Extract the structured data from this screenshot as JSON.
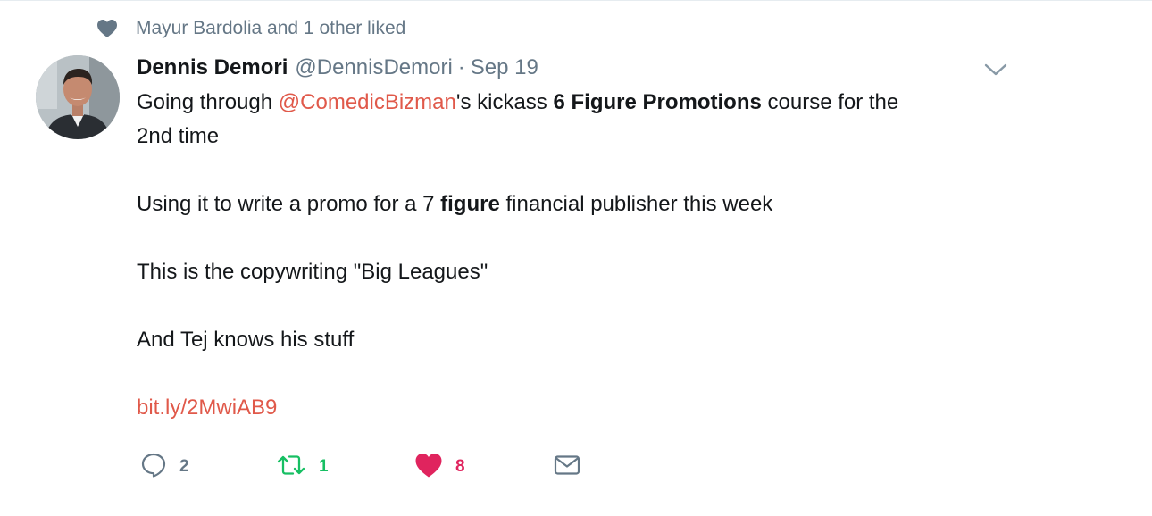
{
  "context": {
    "text": "Mayur Bardolia and 1 other liked",
    "icon": "heart-icon"
  },
  "tweet": {
    "author_name": "Dennis Demori",
    "author_handle": "@DennisDemori",
    "separator": "·",
    "timestamp": "Sep 19",
    "menu_icon": "chevron-down-icon",
    "line1_before": "Going through ",
    "line1_mention": "@ComedicBizman",
    "line1_middle": "'s kickass ",
    "line1_bold": "6 Figure Promotions",
    "line1_after": " course for the",
    "line2": "2nd time",
    "para2_before": "Using it to write a promo for a 7 ",
    "para2_bold": "figure",
    "para2_after": " financial publisher this week",
    "para3": "This is the copywriting \"Big Leagues\"",
    "para4": "And Tej knows his stuff",
    "link": "bit.ly/2MwiAB9"
  },
  "actions": {
    "reply_count": "2",
    "retweet_count": "1",
    "like_count": "8"
  },
  "colors": {
    "accent": "#e0594a",
    "like": "#e0245e",
    "retweet": "#17bf63",
    "muted": "#657786"
  }
}
